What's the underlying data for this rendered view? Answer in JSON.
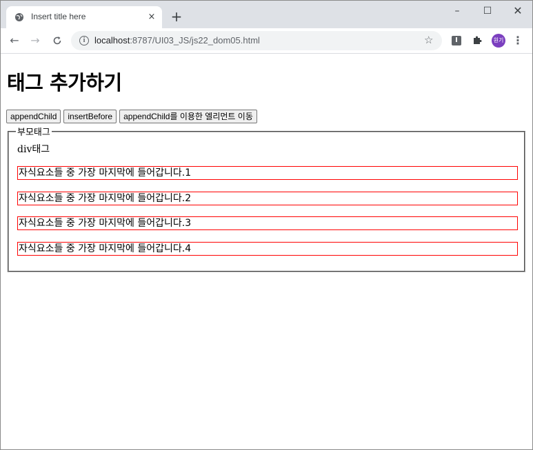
{
  "browser": {
    "tab_title": "Insert title here",
    "tab_close": "×",
    "new_tab": "+",
    "window_min": "–",
    "window_max": "☐",
    "window_close": "✕",
    "url_host": "localhost",
    "url_path": ":8787/UI03_JS/js22_dom05.html",
    "avatar_text": "원기",
    "colors": {
      "tabstrip": "#dee1e6",
      "avatar": "#7b3fbf"
    }
  },
  "page": {
    "title": "태그 추가하기",
    "buttons": [
      "appendChild",
      "insertBefore",
      "appendChild를 이용한 엘리먼트 이동"
    ],
    "fieldset": {
      "legend": "부모태그",
      "div_text": "div태그",
      "children": [
        "자식요소들 중 가장 마지막에 들어갑니다.1",
        "자식요소들 중 가장 마지막에 들어갑니다.2",
        "자식요소들 중 가장 마지막에 들어갑니다.3",
        "자식요소들 중 가장 마지막에 들어갑니다.4"
      ],
      "child_border_color": "#ff0000"
    }
  }
}
